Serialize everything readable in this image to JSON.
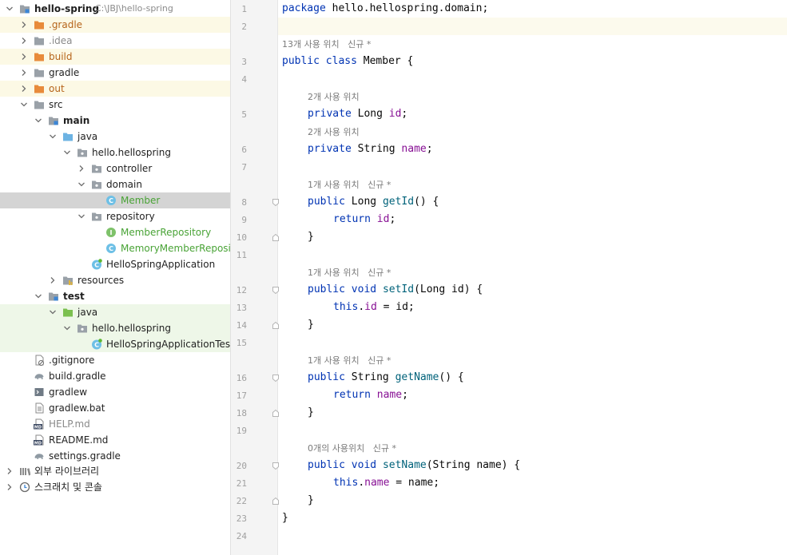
{
  "tree": {
    "project": {
      "name": "hello-spring",
      "path": "C:\\JBJ\\hello-spring"
    },
    "items": {
      "gradle_dot": ".gradle",
      "idea": ".idea",
      "build": "build",
      "gradle": "gradle",
      "out": "out",
      "src": "src",
      "main": "main",
      "java": "java",
      "hello_pkg": "hello.hellospring",
      "controller": "controller",
      "domain": "domain",
      "member": "Member",
      "repository": "repository",
      "member_repository": "MemberRepository",
      "memory_repository": "MemoryMemberRepository",
      "app": "HelloSpringApplication",
      "resources": "resources",
      "test": "test",
      "test_java": "java",
      "test_pkg": "hello.hellospring",
      "app_tests": "HelloSpringApplicationTests",
      "gitignore": ".gitignore",
      "build_gradle": "build.gradle",
      "gradlew": "gradlew",
      "gradlew_bat": "gradlew.bat",
      "help_md": "HELP.md",
      "readme_md": "README.md",
      "settings_gradle": "settings.gradle",
      "external_libs": "외부 라이브러리",
      "scratches": "스크래치 및 콘솔"
    },
    "icon_text": {
      "class_letter": "C",
      "interface_letter": "I",
      "md_badge": "MD"
    }
  },
  "editor": {
    "line_numbers": [
      "1",
      "2",
      "3",
      "4",
      "5",
      "6",
      "7",
      "8",
      "9",
      "10",
      "11",
      "12",
      "13",
      "14",
      "15",
      "16",
      "17",
      "18",
      "19",
      "20",
      "21",
      "22",
      "23",
      "24"
    ],
    "hints": {
      "h13": "13개 사용 위치   신규 *",
      "h2a": "2개 사용 위치",
      "h2b": "2개 사용 위치",
      "h1a": "1개 사용 위치   신규 *",
      "h1b": "1개 사용 위치   신규 *",
      "h1c": "1개 사용 위치   신규 *",
      "h0": "0개의 사용위치   신규 *"
    },
    "tok": {
      "package": "package",
      "pkg_name": " hello.hellospring.domain;",
      "public": "public",
      "class": "class",
      "member_decl": " Member {",
      "private": "private",
      "long_type": " Long ",
      "string_type": " String ",
      "id": "id",
      "name": "name",
      "semi": ";",
      "getId": "getId",
      "getName": "getName",
      "setId": "setId",
      "setName": "setName",
      "paren_open_brace": "() {",
      "return": "return",
      "sp": " ",
      "void": " void ",
      "setId_params": "(Long id) {",
      "setName_params": "(String name) {",
      "this": "this",
      "dot": ".",
      "assign_id": " = id;",
      "assign_name": " = name;",
      "close": "}",
      "long_kw": " Long ",
      "string_kw": " String "
    }
  },
  "colors": {
    "keyword": "#0033b3",
    "method": "#00627a",
    "field": "#871094",
    "excluded_bg": "#fcf9e5",
    "test_bg": "#eef7e8",
    "selected_bg": "#d4d4d4"
  }
}
